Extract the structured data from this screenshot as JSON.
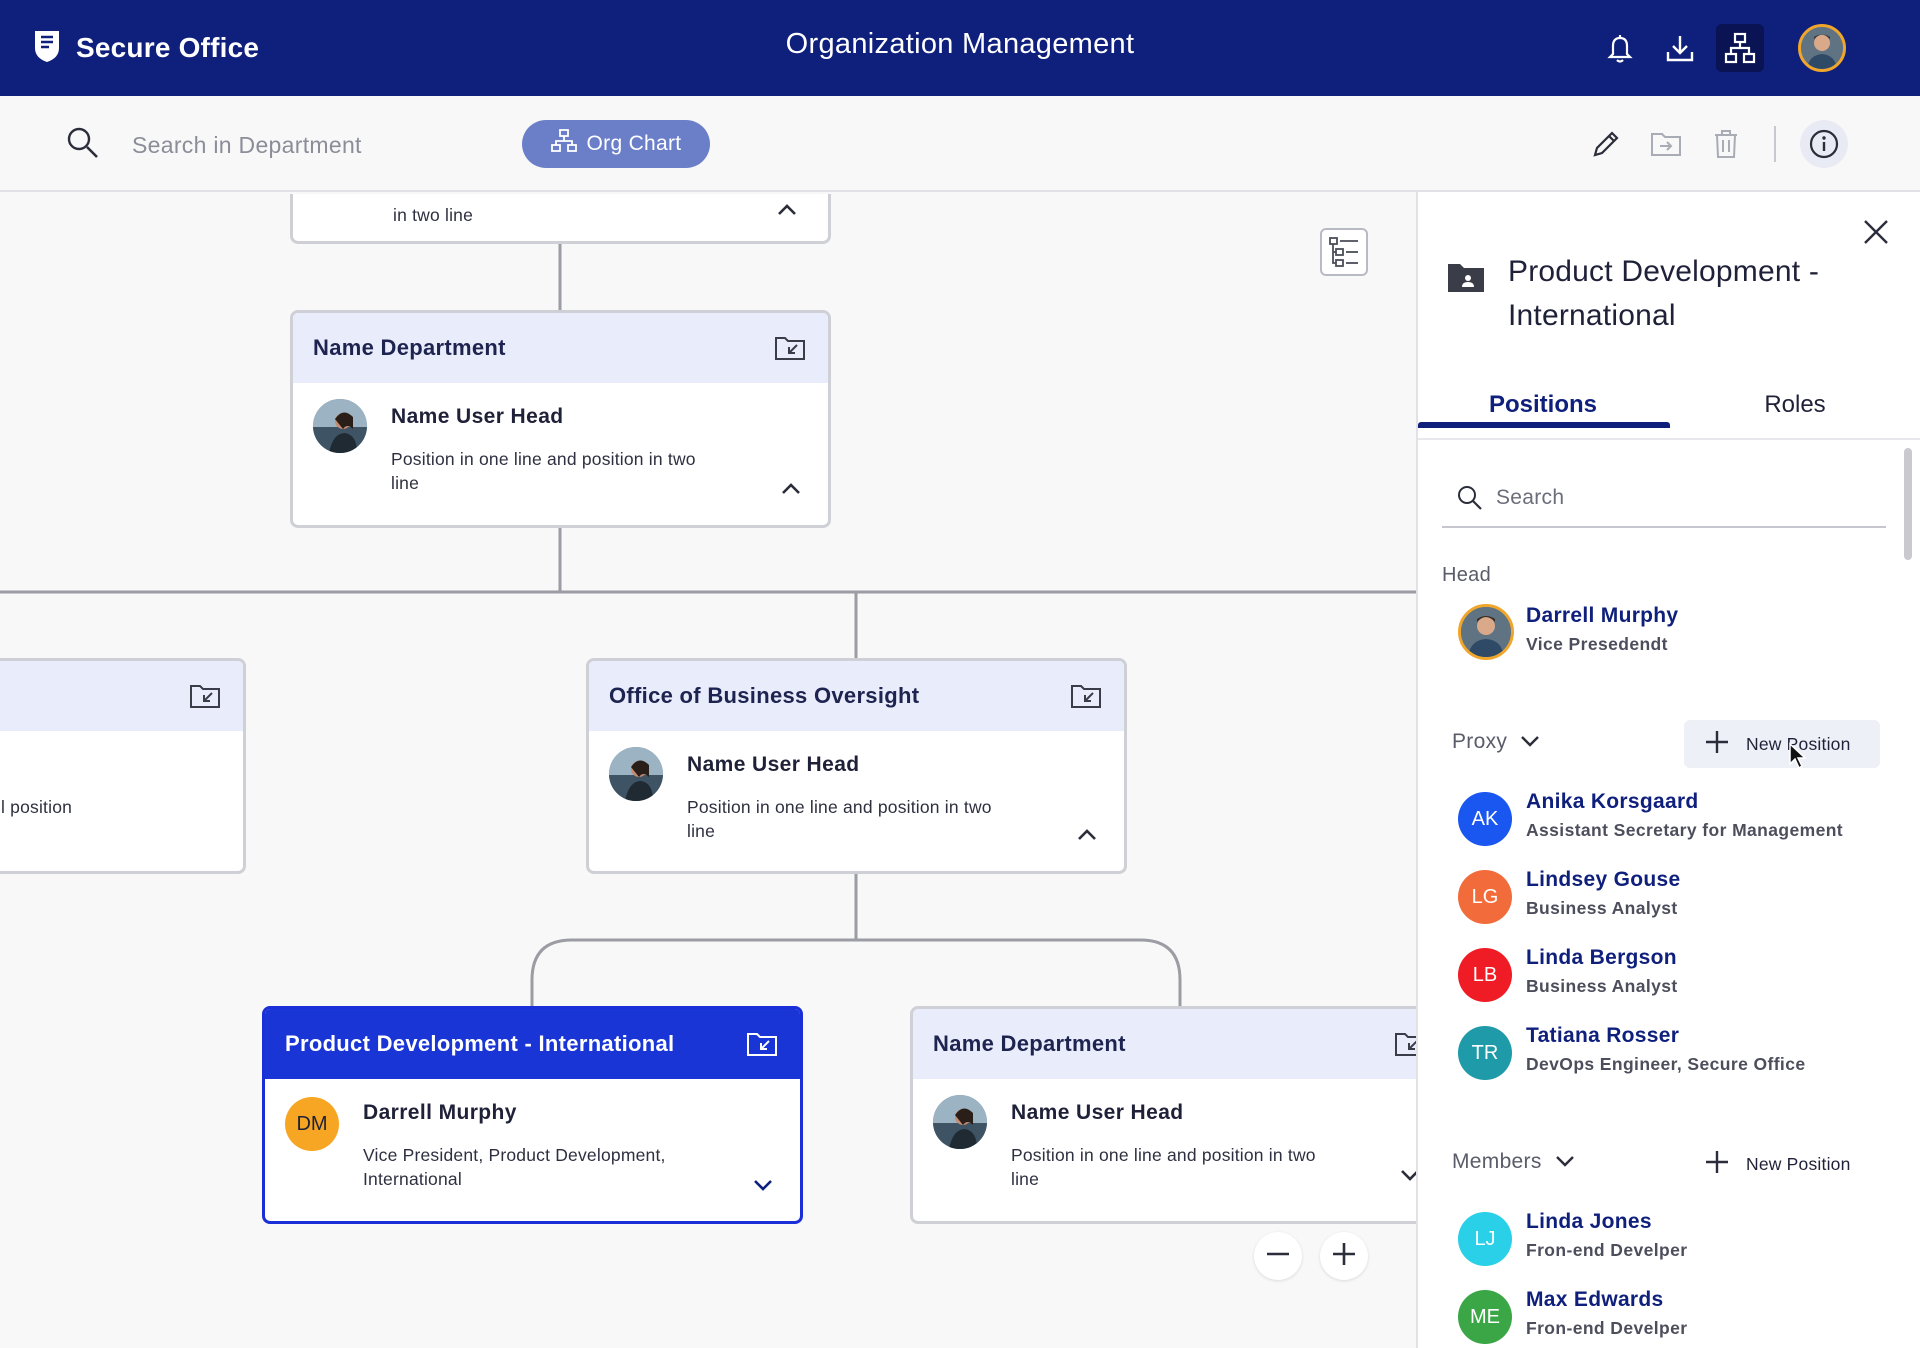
{
  "header": {
    "brand": "Secure Office",
    "title": "Organization Management"
  },
  "toolbar": {
    "search_placeholder": "Search in Department",
    "org_chart_label": "Org Chart"
  },
  "chart": {
    "top_node": {
      "pos_tail": "in two line"
    },
    "name_department": {
      "title": "Name Department",
      "head_name": "Name User Head",
      "head_position": "Position in one line and position in two line"
    },
    "left_node": {
      "pos_tail": "l position"
    },
    "office_node": {
      "title": "Office of Business Oversight",
      "head_name": "Name User Head",
      "head_position": "Position in one line and position in two line"
    },
    "selected_node": {
      "title": "Product Development - International",
      "head_initials": "DM",
      "head_name": "Darrell Murphy",
      "head_position": "Vice President, Product Development, International"
    },
    "right_node": {
      "title": "Name Department",
      "head_name": "Name User Head",
      "head_position": "Position in one line and position in two line"
    }
  },
  "panel": {
    "title": "Product Development - International",
    "tabs": [
      "Positions",
      "Roles"
    ],
    "search_placeholder": "Search",
    "head_label": "Head",
    "head": {
      "name": "Darrell Murphy",
      "title": "Vice Presedendt"
    },
    "proxy_label": "Proxy",
    "new_position_label": "New Position",
    "proxies": [
      {
        "initials": "AK",
        "name": "Anika Korsgaard",
        "title": "Assistant Secretary for Management",
        "color": "#1a56f0"
      },
      {
        "initials": "LG",
        "name": "Lindsey Gouse",
        "title": "Business Analyst",
        "color": "#f26b3a"
      },
      {
        "initials": "LB",
        "name": "Linda Bergson",
        "title": "Business Analyst",
        "color": "#ef1c25"
      },
      {
        "initials": "TR",
        "name": "Tatiana Rosser",
        "title": "DevOps Engineer, Secure Office",
        "color": "#1f9aa8"
      }
    ],
    "members_label": "Members",
    "members": [
      {
        "initials": "LJ",
        "name": "Linda Jones",
        "title": "Fron-end Develper",
        "color": "#29d0e8"
      },
      {
        "initials": "ME",
        "name": "Max Edwards",
        "title": "Fron-end Develper",
        "color": "#3aa646"
      }
    ]
  }
}
